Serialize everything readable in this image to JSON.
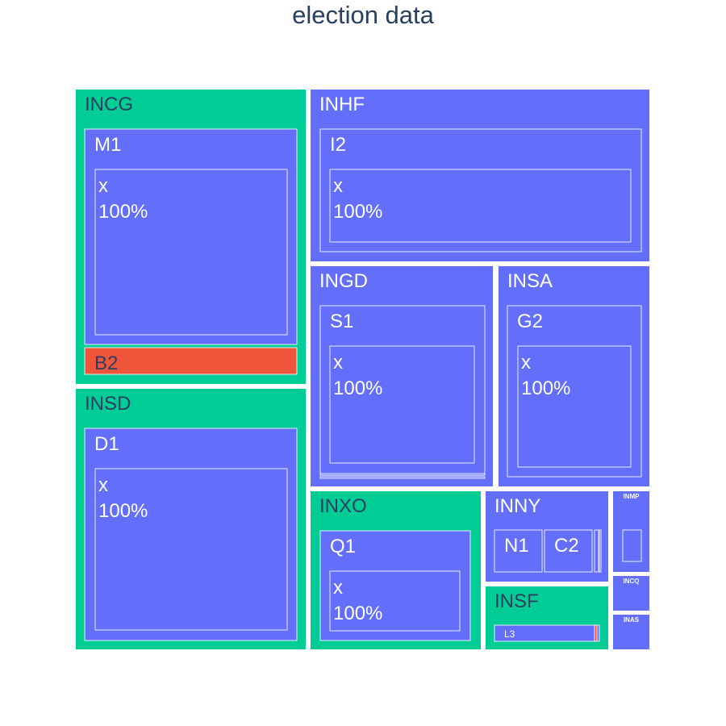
{
  "chart_data": {
    "type": "treemap",
    "title": "election data",
    "colors": {
      "sector_green": "#00cc96",
      "sector_blue": "#636efa",
      "node_blue": "#636efa",
      "node_red": "#ef553b",
      "text_dark": "#2a3f5f",
      "text_light": "#ffffff"
    },
    "nodes": [
      {
        "label": "INCG",
        "color": "sector_green",
        "text": "dark",
        "children": [
          {
            "label": "M1",
            "color": "node_blue",
            "text": "light",
            "children": [
              {
                "label": "x",
                "value_text": "100%",
                "color": "node_blue"
              }
            ]
          },
          {
            "label": "B2",
            "color": "node_red",
            "text": "dark"
          }
        ]
      },
      {
        "label": "INSD",
        "color": "sector_green",
        "text": "dark",
        "children": [
          {
            "label": "D1",
            "color": "node_blue",
            "text": "light",
            "children": [
              {
                "label": "x",
                "value_text": "100%",
                "color": "node_blue"
              }
            ]
          }
        ]
      },
      {
        "label": "INHF",
        "color": "sector_blue",
        "text": "light",
        "children": [
          {
            "label": "I2",
            "color": "node_blue",
            "text": "light",
            "children": [
              {
                "label": "x",
                "value_text": "100%",
                "color": "node_blue"
              }
            ]
          }
        ]
      },
      {
        "label": "INGD",
        "color": "sector_blue",
        "text": "light",
        "children": [
          {
            "label": "S1",
            "color": "node_blue",
            "text": "light",
            "children": [
              {
                "label": "x",
                "value_text": "100%",
                "color": "node_blue"
              }
            ]
          }
        ]
      },
      {
        "label": "INSA",
        "color": "sector_blue",
        "text": "light",
        "children": [
          {
            "label": "G2",
            "color": "node_blue",
            "text": "light",
            "children": [
              {
                "label": "x",
                "value_text": "100%",
                "color": "node_blue"
              }
            ]
          }
        ]
      },
      {
        "label": "INXO",
        "color": "sector_green",
        "text": "dark",
        "children": [
          {
            "label": "Q1",
            "color": "node_blue",
            "text": "light",
            "children": [
              {
                "label": "x",
                "value_text": "100%",
                "color": "node_blue"
              }
            ]
          }
        ]
      },
      {
        "label": "INNY",
        "color": "sector_blue",
        "text": "light",
        "children": [
          {
            "label": "N1",
            "color": "node_blue",
            "text": "light"
          },
          {
            "label": "C2",
            "color": "node_blue",
            "text": "light"
          }
        ]
      },
      {
        "label": "INSF",
        "color": "sector_green",
        "text": "dark",
        "children": [
          {
            "label": "L3",
            "color": "node_blue",
            "text": "light"
          }
        ]
      },
      {
        "label": "INMP",
        "color": "sector_blue",
        "text": "light"
      },
      {
        "label": "INCQ",
        "color": "sector_blue",
        "text": "light"
      },
      {
        "label": "INAS",
        "color": "sector_blue",
        "text": "light"
      }
    ]
  }
}
